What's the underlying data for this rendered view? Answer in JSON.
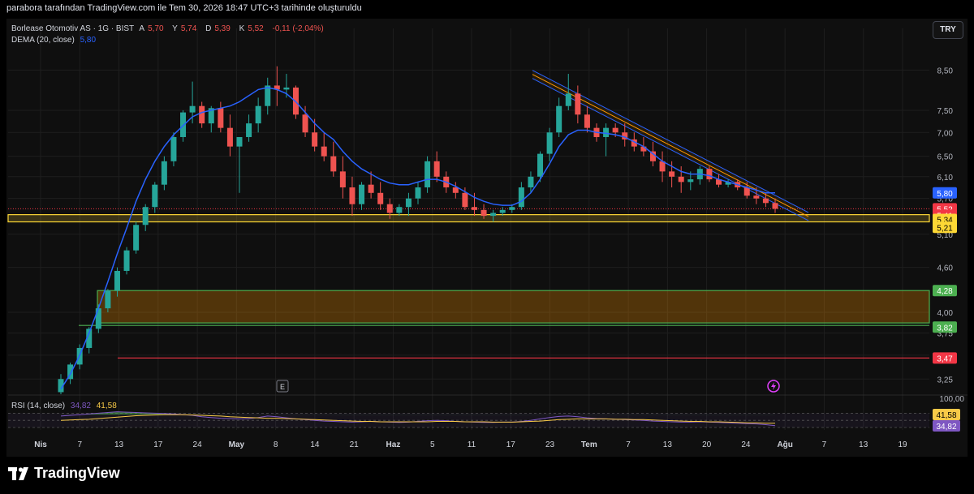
{
  "caption": "parabora tarafından TradingView.com ile Tem 30, 2026 18:47 UTC+3 tarihinde oluşturuldu",
  "currency_button": "TRY",
  "legend": {
    "symbol": "Borlease Otomotiv AS · 1G · BIST",
    "o_label": "A",
    "o_value": "5,70",
    "h_label": "Y",
    "h_value": "5,74",
    "l_label": "D",
    "l_value": "5,39",
    "c_label": "K",
    "c_value": "5,52",
    "change": "-0,11 (-2,04%)",
    "dema_label": "DEMA (20, close)",
    "dema_value": "5,80",
    "rsi_label": "RSI (14, close)",
    "rsi_value": "34,82",
    "rsi_ma_value": "41,58"
  },
  "brand": "TradingView",
  "event_marker": "E",
  "colors": {
    "up": "#26a69a",
    "down": "#ef5350",
    "dema": "#2962ff",
    "rsi": "#7e57c2",
    "rsi_ma": "#f7c948",
    "channel_upper": "#2962ff",
    "channel_mid": "#ff9800",
    "zone_green": "#4caf50",
    "support_red": "#f23645",
    "zone_yellow": "#fdd835"
  },
  "chart_data": {
    "type": "candlestick",
    "y_scale": "log",
    "ylim": [
      3.1,
      9.2
    ],
    "y_ticks": [
      "8,50",
      "7,50",
      "7,00",
      "6,50",
      "6,10",
      "5,70",
      "5,10",
      "4,60",
      "4,00",
      "3,75",
      "3,50",
      "3,25"
    ],
    "x_ticks": [
      "Nis",
      "7",
      "13",
      "17",
      "24",
      "May",
      "8",
      "14",
      "21",
      "Haz",
      "5",
      "11",
      "17",
      "23",
      "Tem",
      "7",
      "13",
      "20",
      "24",
      "Ağu",
      "7",
      "13",
      "19"
    ],
    "price_labels": [
      {
        "value": 5.8,
        "text": "5,80",
        "color": "#2962ff"
      },
      {
        "value": 5.52,
        "text": "5,52",
        "color": "#f23645"
      },
      {
        "value": 5.41,
        "text": "5,41",
        "color": "#f23645"
      },
      {
        "value": 5.34,
        "text": "5,34",
        "color": "#fdd835"
      },
      {
        "value": 5.21,
        "text": "5,21",
        "color": "#fdd835"
      },
      {
        "value": 4.28,
        "text": "4,28",
        "color": "#4caf50"
      },
      {
        "value": 3.82,
        "text": "3,82",
        "color": "#4caf50"
      },
      {
        "value": 3.47,
        "text": "3,47",
        "color": "#f23645"
      }
    ],
    "levels": {
      "yellow_zone": [
        5.3,
        5.42
      ],
      "green_zone": [
        3.87,
        4.28
      ],
      "green_line": 3.84,
      "red_line": 3.47,
      "dotted_line": 5.52
    },
    "trendline": {
      "from": [
        2026.23,
        8.45
      ],
      "to": [
        2026.32,
        5.43
      ]
    },
    "candles": [
      [
        3.12,
        3.3,
        3.1,
        3.25
      ],
      [
        3.25,
        3.42,
        3.2,
        3.4
      ],
      [
        3.4,
        3.62,
        3.35,
        3.58
      ],
      [
        3.58,
        3.82,
        3.52,
        3.8
      ],
      [
        3.8,
        4.1,
        3.75,
        4.05
      ],
      [
        4.05,
        4.3,
        4.0,
        4.28
      ],
      [
        4.28,
        4.6,
        4.2,
        4.55
      ],
      [
        4.55,
        4.9,
        4.5,
        4.85
      ],
      [
        4.85,
        5.3,
        4.8,
        5.25
      ],
      [
        5.25,
        5.6,
        5.15,
        5.55
      ],
      [
        5.55,
        6.0,
        5.45,
        5.95
      ],
      [
        5.95,
        6.5,
        5.85,
        6.4
      ],
      [
        6.4,
        7.0,
        6.3,
        6.9
      ],
      [
        6.9,
        7.5,
        6.8,
        7.45
      ],
      [
        7.45,
        8.2,
        7.2,
        7.6
      ],
      [
        7.6,
        7.7,
        7.1,
        7.2
      ],
      [
        7.2,
        7.6,
        7.0,
        7.55
      ],
      [
        7.55,
        7.7,
        7.0,
        7.1
      ],
      [
        7.1,
        7.4,
        6.5,
        6.7
      ],
      [
        6.7,
        6.9,
        5.8,
        6.9
      ],
      [
        6.9,
        7.4,
        6.8,
        7.2
      ],
      [
        7.2,
        7.8,
        7.0,
        7.6
      ],
      [
        7.6,
        8.3,
        7.4,
        8.1
      ],
      [
        8.1,
        8.6,
        7.6,
        8.0
      ],
      [
        8.0,
        8.4,
        7.8,
        8.05
      ],
      [
        8.05,
        8.1,
        7.3,
        7.4
      ],
      [
        7.4,
        7.6,
        6.9,
        7.0
      ],
      [
        7.0,
        7.3,
        6.6,
        6.7
      ],
      [
        6.7,
        7.0,
        6.4,
        6.5
      ],
      [
        6.5,
        6.8,
        6.1,
        6.2
      ],
      [
        6.2,
        6.5,
        5.7,
        5.9
      ],
      [
        5.9,
        6.1,
        5.4,
        5.6
      ],
      [
        5.6,
        6.0,
        5.5,
        5.95
      ],
      [
        5.95,
        6.2,
        5.7,
        5.8
      ],
      [
        5.8,
        6.0,
        5.5,
        5.6
      ],
      [
        5.6,
        5.7,
        5.35,
        5.45
      ],
      [
        5.45,
        5.6,
        5.4,
        5.55
      ],
      [
        5.55,
        5.8,
        5.4,
        5.7
      ],
      [
        5.7,
        6.0,
        5.6,
        5.9
      ],
      [
        5.9,
        6.5,
        5.8,
        6.4
      ],
      [
        6.4,
        6.6,
        6.0,
        6.1
      ],
      [
        6.1,
        6.2,
        5.8,
        5.9
      ],
      [
        5.9,
        6.0,
        5.7,
        5.8
      ],
      [
        5.8,
        5.9,
        5.5,
        5.55
      ],
      [
        5.55,
        5.8,
        5.4,
        5.5
      ],
      [
        5.5,
        5.6,
        5.35,
        5.4
      ],
      [
        5.4,
        5.5,
        5.3,
        5.45
      ],
      [
        5.45,
        5.55,
        5.4,
        5.5
      ],
      [
        5.5,
        5.6,
        5.45,
        5.55
      ],
      [
        5.55,
        6.0,
        5.5,
        5.9
      ],
      [
        5.9,
        6.2,
        5.8,
        6.1
      ],
      [
        6.1,
        6.6,
        6.0,
        6.55
      ],
      [
        6.55,
        7.1,
        6.4,
        7.0
      ],
      [
        7.0,
        7.8,
        6.9,
        7.6
      ],
      [
        7.6,
        8.4,
        7.5,
        7.9
      ],
      [
        7.9,
        8.1,
        7.2,
        7.4
      ],
      [
        7.4,
        7.6,
        7.0,
        7.1
      ],
      [
        7.1,
        7.2,
        6.8,
        6.9
      ],
      [
        6.9,
        7.2,
        6.5,
        7.1
      ],
      [
        7.1,
        7.2,
        6.9,
        7.0
      ],
      [
        7.0,
        7.2,
        6.7,
        6.85
      ],
      [
        6.85,
        7.0,
        6.6,
        6.7
      ],
      [
        6.7,
        6.9,
        6.5,
        6.6
      ],
      [
        6.6,
        6.8,
        6.3,
        6.4
      ],
      [
        6.4,
        6.6,
        6.0,
        6.2
      ],
      [
        6.2,
        6.4,
        5.9,
        6.1
      ],
      [
        6.1,
        6.3,
        5.8,
        6.0
      ],
      [
        6.0,
        6.2,
        5.85,
        6.05
      ],
      [
        6.05,
        6.3,
        5.95,
        6.25
      ],
      [
        6.25,
        6.3,
        6.0,
        6.05
      ],
      [
        6.05,
        6.15,
        5.9,
        5.95
      ],
      [
        5.95,
        6.05,
        5.9,
        6.0
      ],
      [
        6.0,
        6.05,
        5.85,
        5.9
      ],
      [
        5.9,
        6.0,
        5.7,
        5.75
      ],
      [
        5.75,
        5.9,
        5.6,
        5.7
      ],
      [
        5.7,
        5.8,
        5.55,
        5.62
      ],
      [
        5.62,
        5.7,
        5.45,
        5.52
      ]
    ],
    "dema": [
      3.15,
      3.3,
      3.5,
      3.75,
      4.05,
      4.4,
      4.8,
      5.2,
      5.65,
      6.05,
      6.4,
      6.7,
      6.95,
      7.15,
      7.35,
      7.45,
      7.5,
      7.55,
      7.6,
      7.7,
      7.85,
      8.0,
      8.05,
      8.0,
      7.9,
      7.7,
      7.45,
      7.2,
      7.0,
      6.85,
      6.6,
      6.4,
      6.25,
      6.15,
      6.05,
      5.98,
      5.95,
      5.95,
      6.0,
      6.05,
      6.05,
      6.0,
      5.92,
      5.82,
      5.72,
      5.65,
      5.6,
      5.58,
      5.58,
      5.65,
      5.8,
      6.05,
      6.35,
      6.7,
      6.95,
      7.05,
      7.05,
      7.0,
      6.98,
      6.95,
      6.9,
      6.8,
      6.7,
      6.55,
      6.4,
      6.3,
      6.2,
      6.15,
      6.15,
      6.12,
      6.05,
      6.0,
      5.95,
      5.9,
      5.85,
      5.8,
      5.8
    ],
    "rsi": [
      62,
      64,
      66,
      68,
      70,
      72,
      74,
      73,
      72,
      71,
      70,
      69,
      68,
      66,
      64,
      60,
      58,
      56,
      55,
      54,
      55,
      58,
      62,
      60,
      57,
      54,
      52,
      50,
      48,
      47,
      46,
      45,
      46,
      47,
      46,
      45,
      44,
      45,
      47,
      49,
      50,
      49,
      47,
      46,
      45,
      44,
      44,
      45,
      45,
      47,
      50,
      54,
      58,
      61,
      62,
      60,
      57,
      55,
      54,
      53,
      52,
      51,
      50,
      48,
      47,
      46,
      45,
      45,
      46,
      45,
      44,
      43,
      42,
      41,
      40,
      38,
      35
    ],
    "rsi_ma": [
      50,
      51,
      52,
      53,
      55,
      57,
      59,
      61,
      63,
      64,
      65,
      66,
      66,
      66,
      65,
      64,
      63,
      62,
      60,
      59,
      58,
      57,
      56,
      56,
      55,
      54,
      53,
      52,
      51,
      50,
      49,
      48,
      47,
      47,
      46,
      46,
      46,
      46,
      46,
      46,
      47,
      47,
      47,
      46,
      46,
      46,
      45,
      45,
      45,
      46,
      47,
      48,
      50,
      52,
      53,
      54,
      54,
      54,
      54,
      53,
      53,
      52,
      52,
      51,
      50,
      49,
      48,
      47,
      47,
      46,
      46,
      45,
      44,
      43,
      43,
      42,
      42
    ],
    "rsi_ylim": [
      30,
      80
    ],
    "rsi_ticks": [
      "100,00"
    ]
  }
}
